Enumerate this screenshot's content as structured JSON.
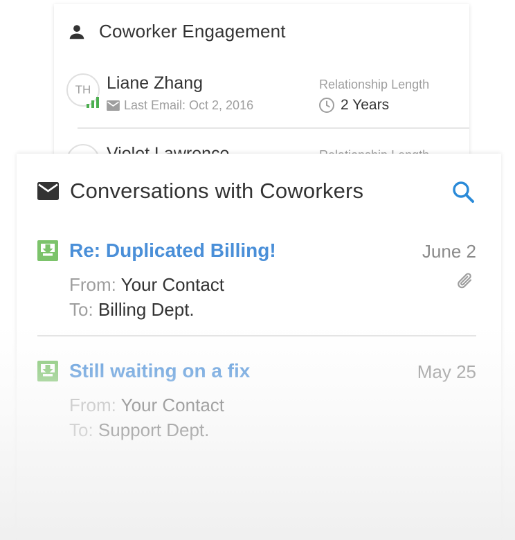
{
  "engagement": {
    "title": "Coworker Engagement",
    "contacts": [
      {
        "initials": "TH",
        "name": "Liane Zhang",
        "last_email": "Last Email: Oct 2, 2016",
        "relationship_label": "Relationship Length",
        "relationship_value": "2 Years"
      },
      {
        "name": "Violet Lawrence",
        "relationship_label": "Relationship Length"
      }
    ]
  },
  "conversations": {
    "title": "Conversations with Coworkers",
    "messages": [
      {
        "subject": "Re: Duplicated Billing!",
        "date": "June 2",
        "from_label": "From:",
        "from": "Your Contact",
        "to_label": "To:",
        "to": "Billing Dept.",
        "has_attachment": true
      },
      {
        "subject": "Still waiting on a fix",
        "date": "May 25",
        "from_label": "From:",
        "from": "Your Contact",
        "to_label": "To:",
        "to": "Support Dept.",
        "has_attachment": false
      }
    ]
  },
  "icons": {
    "person": "person-icon",
    "envelope": "envelope-icon",
    "search": "search-icon",
    "inbox": "inbox-download-icon",
    "attachment": "paperclip-icon",
    "clock": "clock-icon",
    "mail": "mail-icon",
    "signal": "signal-bars-icon"
  },
  "colors": {
    "link_blue": "#4a8fd8",
    "search_blue": "#2a8ad8",
    "inbox_green": "#7cc36b",
    "signal_green": "#4caf50",
    "muted_gray": "#9e9e9e"
  }
}
